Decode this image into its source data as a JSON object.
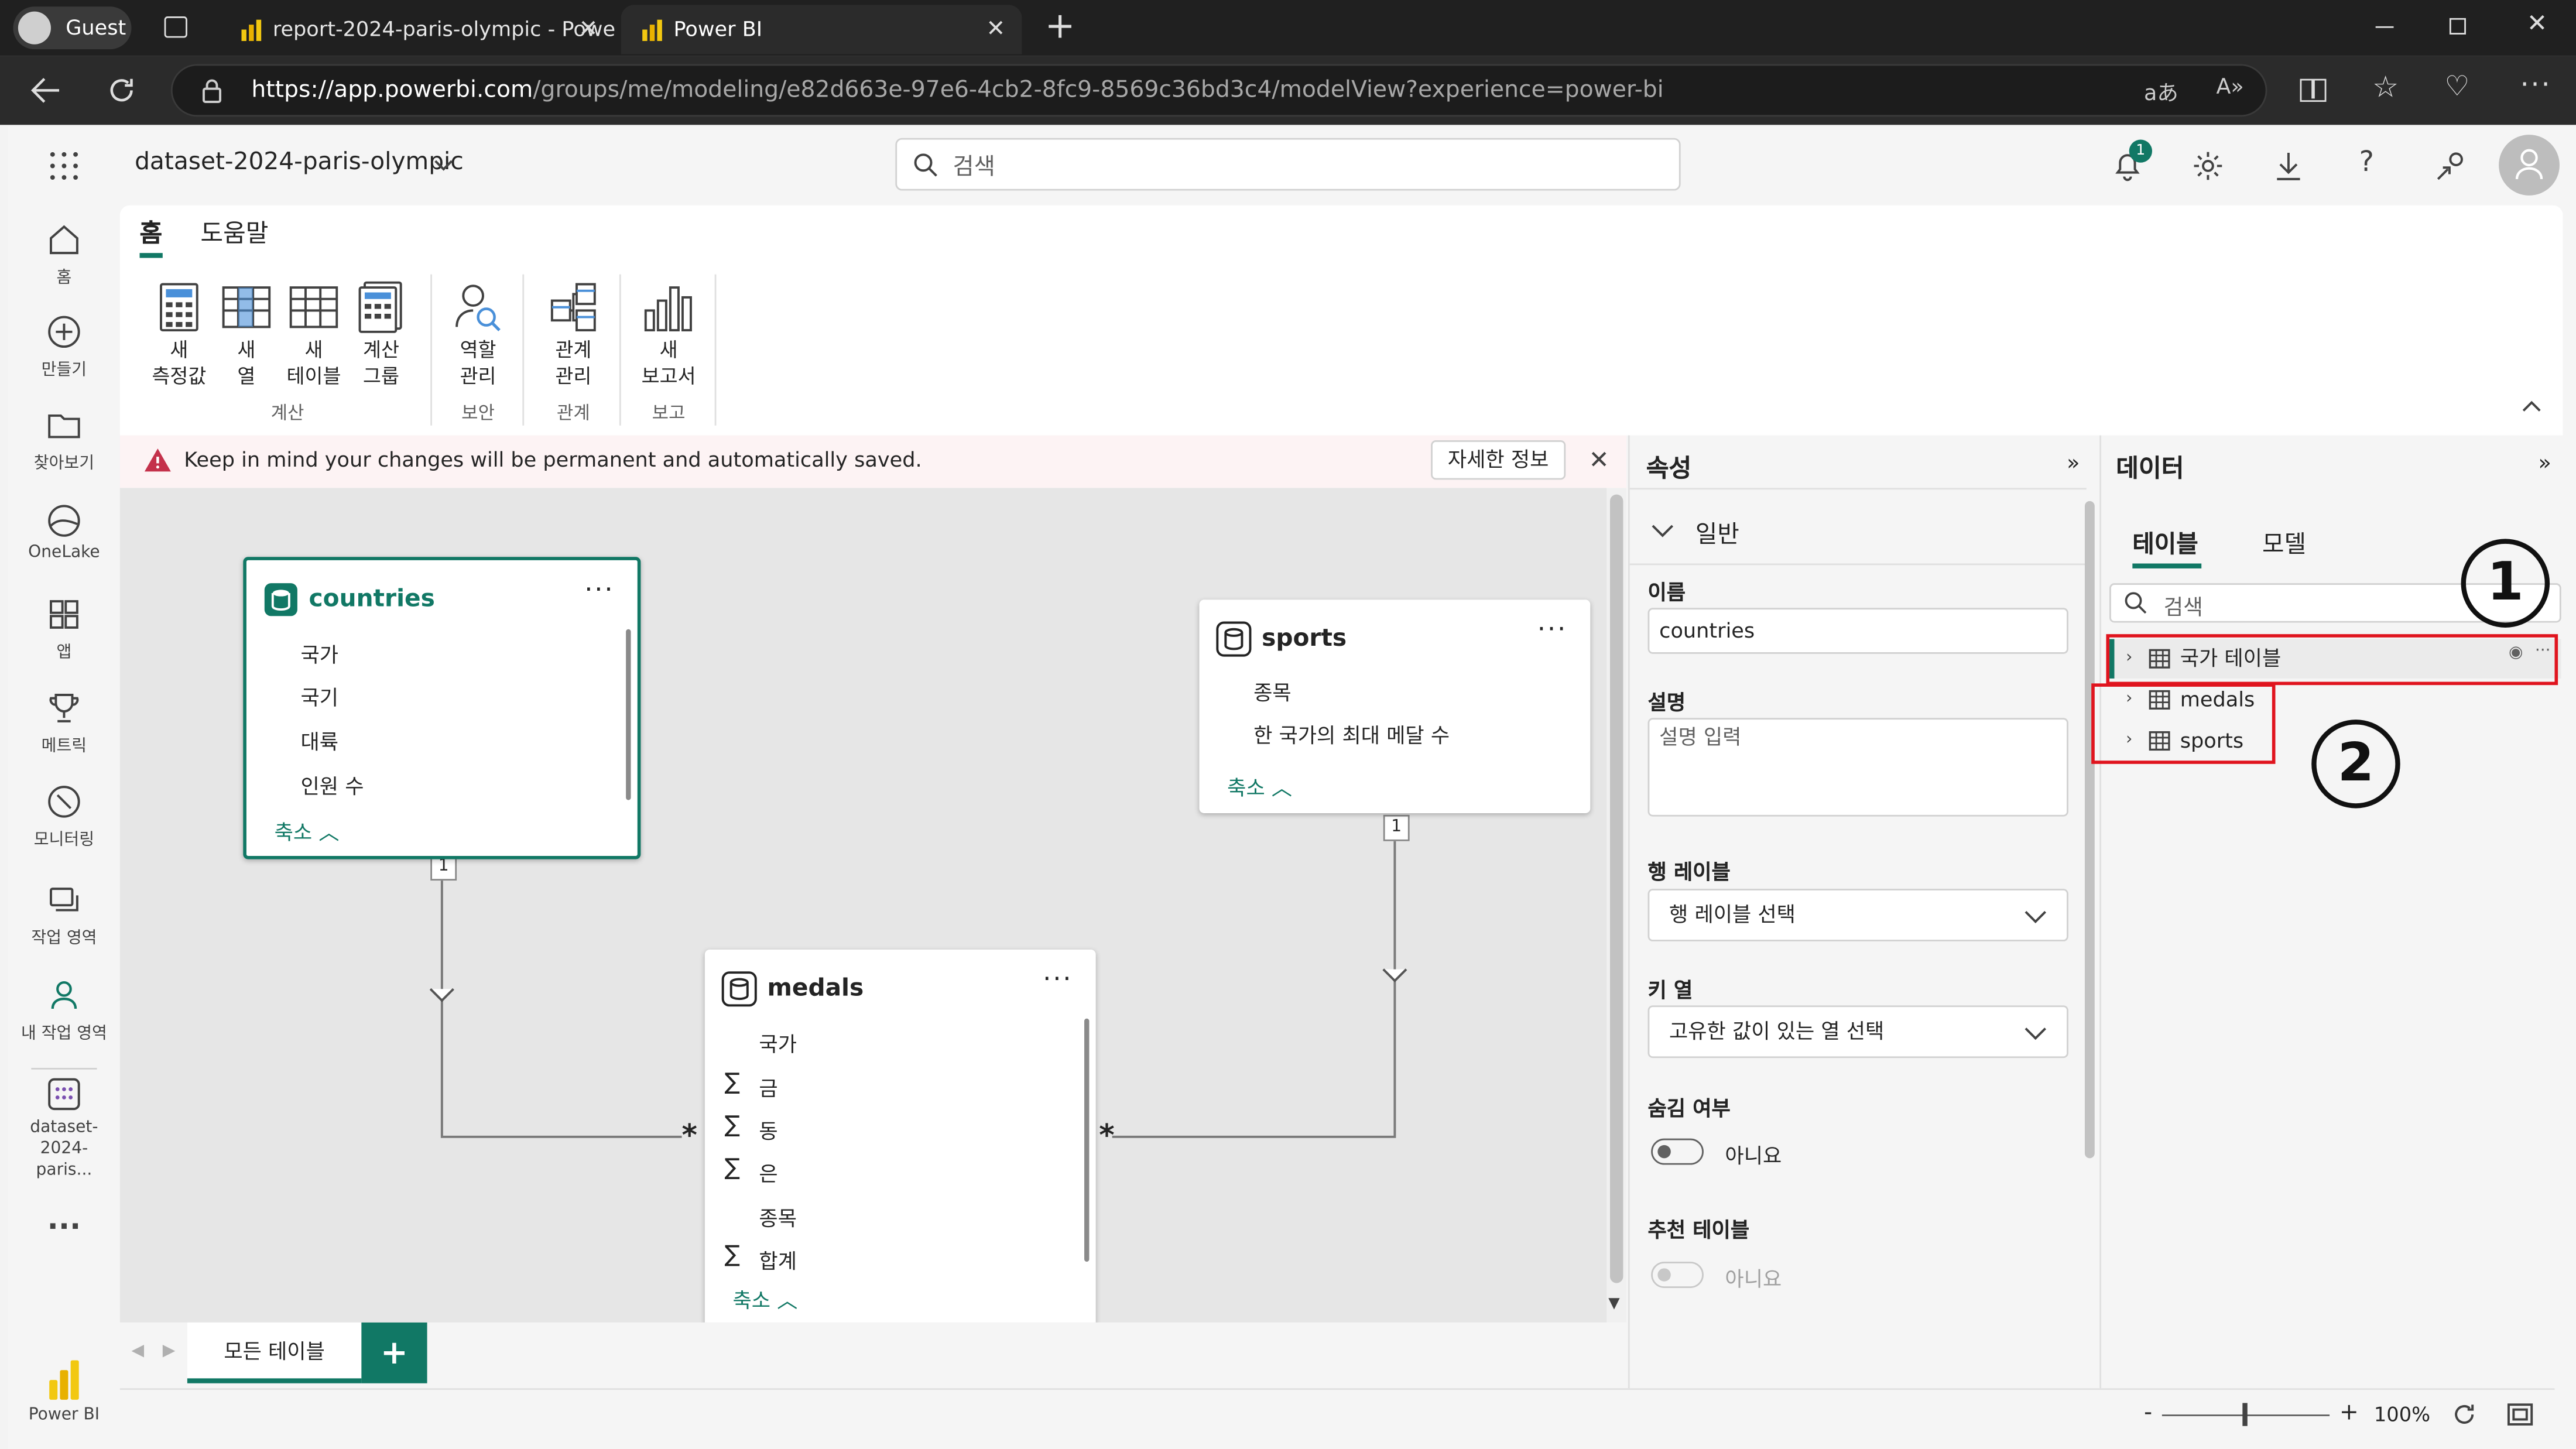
{
  "browser": {
    "profile": "Guest",
    "tabs": [
      {
        "title": "report-2024-paris-olympic - Powe"
      },
      {
        "title": "Power BI"
      }
    ],
    "url_host": "https://app.powerbi.com",
    "url_path": "/groups/me/modeling/e82d663e-97e6-4cb2-8fc9-8569c36bd3c4/modelView?experience=power-bi"
  },
  "header": {
    "dataset_name": "dataset-2024-paris-olympic",
    "search_placeholder": "검색",
    "notification_count": "1"
  },
  "leftnav": {
    "items": [
      {
        "label": "홈",
        "icon": "home-icon"
      },
      {
        "label": "만들기",
        "icon": "plus-circle-icon"
      },
      {
        "label": "찾아보기",
        "icon": "folder-icon"
      },
      {
        "label": "OneLake",
        "icon": "onelake-icon"
      },
      {
        "label": "앱",
        "icon": "apps-icon"
      },
      {
        "label": "메트릭",
        "icon": "trophy-icon"
      },
      {
        "label": "모니터링",
        "icon": "monitor-icon"
      },
      {
        "label": "작업 영역",
        "icon": "workspaces-icon"
      },
      {
        "label": "내 작업 영역",
        "icon": "person-icon"
      },
      {
        "label": "dataset-2024-paris...",
        "icon": "dataset-icon"
      }
    ],
    "more": "...",
    "product": "Power BI"
  },
  "ribbon": {
    "tabs": [
      "홈",
      "도움말"
    ],
    "buttons": {
      "new_measure": [
        "새",
        "측정값"
      ],
      "new_column": [
        "새",
        "열"
      ],
      "new_table": [
        "새",
        "테이블"
      ],
      "calc_group": [
        "계산",
        "그룹"
      ],
      "manage_roles": [
        "역할",
        "관리"
      ],
      "manage_relationships": [
        "관계",
        "관리"
      ],
      "new_report": [
        "새",
        "보고서"
      ]
    },
    "groups": [
      "계산",
      "보안",
      "관계",
      "보고"
    ]
  },
  "warning": {
    "message": "Keep in mind your changes will be permanent and automatically saved.",
    "details_button": "자세한 정보"
  },
  "model": {
    "countries": {
      "name": "countries",
      "fields": [
        "국가",
        "국기",
        "대륙",
        "인원 수"
      ],
      "collapse": "축소"
    },
    "sports": {
      "name": "sports",
      "fields": [
        "종목",
        "한 국가의 최대 메달 수"
      ],
      "collapse": "축소"
    },
    "medals": {
      "name": "medals",
      "fields": [
        {
          "name": "국가",
          "sigma": ""
        },
        {
          "name": "금",
          "sigma": "∑"
        },
        {
          "name": "동",
          "sigma": "∑"
        },
        {
          "name": "은",
          "sigma": "∑"
        },
        {
          "name": "종목",
          "sigma": ""
        },
        {
          "name": "합계",
          "sigma": "∑"
        }
      ],
      "collapse": "축소"
    },
    "cardinality": {
      "one": "1",
      "many": "*"
    }
  },
  "bottom": {
    "page_tab": "모든 테이블",
    "add": "+"
  },
  "status": {
    "zoom": "100%",
    "minus": "-",
    "plus": "+"
  },
  "properties": {
    "title": "속성",
    "section": "일반",
    "name_label": "이름",
    "name_value": "countries",
    "desc_label": "설명",
    "desc_placeholder": "설명 입력",
    "row_label_label": "행 레이블",
    "row_label_value": "행 레이블 선택",
    "key_col_label": "키 열",
    "key_col_value": "고유한 값이 있는 열 선택",
    "hidden_label": "숨김 여부",
    "hidden_value": "아니요",
    "featured_label": "추천 테이블",
    "featured_value": "아니요"
  },
  "data_pane": {
    "title": "데이터",
    "tabs": [
      "테이블",
      "모델"
    ],
    "search_placeholder": "검색",
    "tables": [
      "국가 테이블",
      "medals",
      "sports"
    ]
  },
  "annotations": {
    "one": "1",
    "two": "2"
  }
}
